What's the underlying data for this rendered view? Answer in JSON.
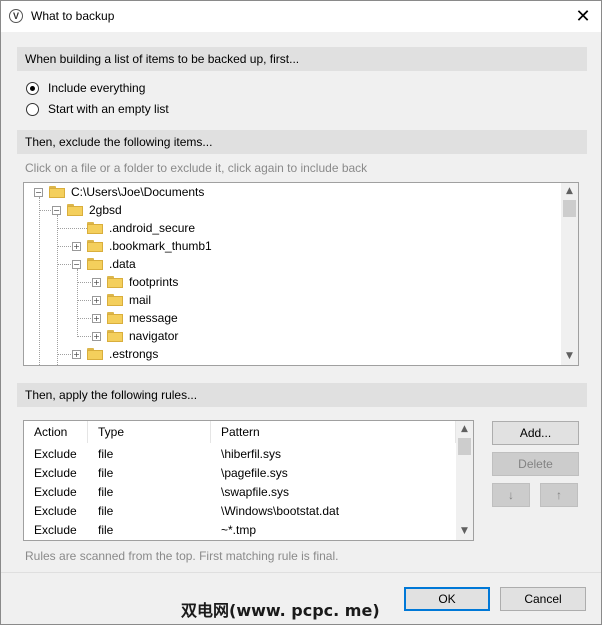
{
  "window": {
    "title": "What to backup",
    "app_icon_glyph": "V"
  },
  "section1": {
    "header": "When building a list of items to be backed up, first...",
    "options": [
      {
        "label": "Include everything",
        "checked": true
      },
      {
        "label": "Start with an empty list",
        "checked": false
      }
    ]
  },
  "section2": {
    "header": "Then, exclude the following items...",
    "hint": "Click on a file or a folder to exclude it, click again to include back",
    "tree": [
      {
        "label": "C:\\Users\\Joe\\Documents",
        "expander": "−"
      },
      {
        "label": "2gbsd",
        "expander": "−"
      },
      {
        "label": ".android_secure",
        "expander": ""
      },
      {
        "label": ".bookmark_thumb1",
        "expander": "+"
      },
      {
        "label": ".data",
        "expander": "−"
      },
      {
        "label": "footprints",
        "expander": "+"
      },
      {
        "label": "mail",
        "expander": "+"
      },
      {
        "label": "message",
        "expander": "+"
      },
      {
        "label": "navigator",
        "expander": "+"
      },
      {
        "label": ".estrongs",
        "expander": "+"
      }
    ]
  },
  "section3": {
    "header": "Then, apply the following rules...",
    "columns": [
      "Action",
      "Type",
      "Pattern"
    ],
    "rows": [
      {
        "action": "Exclude",
        "type": "file",
        "pattern": "\\hiberfil.sys"
      },
      {
        "action": "Exclude",
        "type": "file",
        "pattern": "\\pagefile.sys"
      },
      {
        "action": "Exclude",
        "type": "file",
        "pattern": "\\swapfile.sys"
      },
      {
        "action": "Exclude",
        "type": "file",
        "pattern": "\\Windows\\bootstat.dat"
      },
      {
        "action": "Exclude",
        "type": "file",
        "pattern": "~*.tmp"
      }
    ],
    "buttons": {
      "add": "Add...",
      "delete": "Delete",
      "move_down": "↓",
      "move_up": "↑"
    },
    "footnote": "Rules are scanned from the top. First matching rule is final."
  },
  "footer": {
    "ok": "OK",
    "cancel": "Cancel",
    "watermark": "双电网(www. pcpc. me)"
  },
  "colors": {
    "accent": "#0078d7",
    "section_bg": "#e0e0e0",
    "dialog_bg": "#f0f0f0",
    "folder": "#f4cf5c"
  }
}
